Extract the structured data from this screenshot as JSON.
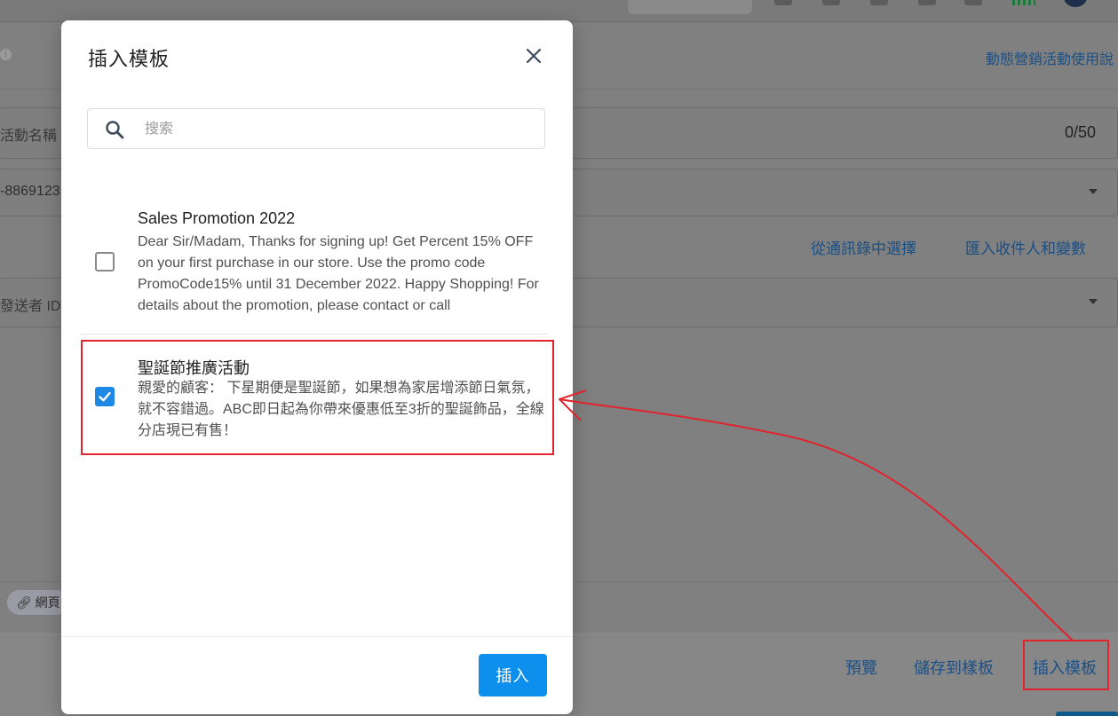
{
  "background": {
    "top_right_link": "動態營銷活動使用說",
    "campaign_name_label": "活動名稱",
    "char_counter": "0/50",
    "phone_value": "-8869123",
    "contacts_link": "從通訊錄中選擇",
    "import_link": "匯入收件人和變數",
    "sender_id_label": "發送者 ID",
    "link_chip": "網頁",
    "preview_button": "預覽",
    "save_template_button": "儲存到樣板",
    "insert_template_button": "插入模板"
  },
  "modal": {
    "title": "插入模板",
    "search_placeholder": "搜索",
    "templates": [
      {
        "name": "Sales Promotion 2022",
        "body": "Dear Sir/Madam, Thanks for signing up! Get Percent 15% OFF on your first purchase in our store. Use the promo code PromoCode15% until 31 December 2022. Happy Shopping! For details about the promotion, please contact or call",
        "checked": false
      },
      {
        "name": "聖誕節推廣活動",
        "body": "親愛的顧客： 下星期便是聖誕節，如果想為家居增添節日氣氛，就不容錯過。ABC即日起為你帶來優惠低至3折的聖誕飾品，全線分店現已有售！",
        "checked": true
      }
    ],
    "insert_button": "插入"
  },
  "colors": {
    "accent": "#1e88e5",
    "primary_button": "#0d8fee",
    "annotation_red": "#e0242e"
  }
}
